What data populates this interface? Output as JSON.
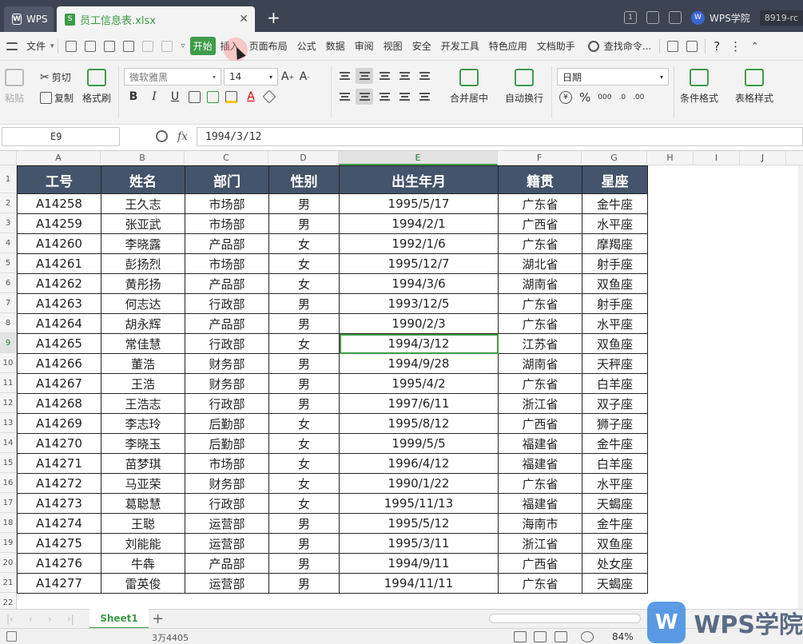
{
  "titlebar": {
    "app_tab": "WPS",
    "file_tab": "员工信息表.xlsx",
    "page_badge": "1",
    "academy": "WPS学院",
    "user": "8919-rc"
  },
  "menubar": {
    "file": "文件",
    "items": [
      "开始",
      "插入",
      "页面布局",
      "公式",
      "数据",
      "审阅",
      "视图",
      "安全",
      "开发工具",
      "特色应用",
      "文档助手"
    ],
    "search": "查找命令..."
  },
  "ribbon": {
    "paste": "粘贴",
    "cut": "剪切",
    "copy": "复制",
    "format_painter": "格式刷",
    "font_name": "微软雅黑",
    "font_size": "14",
    "bold": "B",
    "italic": "I",
    "underline": "U",
    "merge_center": "合并居中",
    "wrap_text": "自动换行",
    "number_format": "日期",
    "percent": "%",
    "conditional_format": "条件格式",
    "table_style": "表格样式"
  },
  "formula_bar": {
    "name_box": "E9",
    "fx": "fx",
    "value": "1994/3/12"
  },
  "grid": {
    "columns": [
      "A",
      "B",
      "C",
      "D",
      "E",
      "F",
      "G",
      "H",
      "I",
      "J"
    ],
    "selected_column": "E",
    "selected_row": 9,
    "rows": [
      "1",
      "2",
      "3",
      "4",
      "5",
      "6",
      "7",
      "8",
      "9",
      "10",
      "11",
      "12",
      "13",
      "14",
      "15",
      "16",
      "17",
      "18",
      "19",
      "20",
      "21",
      "22"
    ]
  },
  "table": {
    "headers": [
      "工号",
      "姓名",
      "部门",
      "性别",
      "出生年月",
      "籍贯",
      "星座"
    ],
    "rows": [
      [
        "A14258",
        "王久志",
        "市场部",
        "男",
        "1995/5/17",
        "广东省",
        "金牛座"
      ],
      [
        "A14259",
        "张亚武",
        "市场部",
        "男",
        "1994/2/1",
        "广西省",
        "水平座"
      ],
      [
        "A14260",
        "李晓露",
        "产品部",
        "女",
        "1992/1/6",
        "广东省",
        "摩羯座"
      ],
      [
        "A14261",
        "彭扬烈",
        "市场部",
        "女",
        "1995/12/7",
        "湖北省",
        "射手座"
      ],
      [
        "A14262",
        "黄彤扬",
        "产品部",
        "女",
        "1994/3/6",
        "湖南省",
        "双鱼座"
      ],
      [
        "A14263",
        "何志达",
        "行政部",
        "男",
        "1993/12/5",
        "广东省",
        "射手座"
      ],
      [
        "A14264",
        "胡永辉",
        "产品部",
        "男",
        "1990/2/3",
        "广东省",
        "水平座"
      ],
      [
        "A14265",
        "常佳慧",
        "行政部",
        "女",
        "1994/3/12",
        "江苏省",
        "双鱼座"
      ],
      [
        "A14266",
        "董浩",
        "财务部",
        "男",
        "1994/9/28",
        "湖南省",
        "天秤座"
      ],
      [
        "A14267",
        "王浩",
        "财务部",
        "男",
        "1995/4/2",
        "广东省",
        "白羊座"
      ],
      [
        "A14268",
        "王浩志",
        "行政部",
        "男",
        "1997/6/11",
        "浙江省",
        "双子座"
      ],
      [
        "A14269",
        "李志玲",
        "后勤部",
        "女",
        "1995/8/12",
        "广西省",
        "狮子座"
      ],
      [
        "A14270",
        "李晓玉",
        "后勤部",
        "女",
        "1999/5/5",
        "福建省",
        "金牛座"
      ],
      [
        "A14271",
        "苗梦琪",
        "市场部",
        "女",
        "1996/4/12",
        "福建省",
        "白羊座"
      ],
      [
        "A14272",
        "马亚荣",
        "财务部",
        "女",
        "1990/1/22",
        "广东省",
        "水平座"
      ],
      [
        "A14273",
        "葛聪慧",
        "行政部",
        "女",
        "1995/11/13",
        "福建省",
        "天蝎座"
      ],
      [
        "A14274",
        "王聪",
        "运营部",
        "男",
        "1995/5/12",
        "海南市",
        "金牛座"
      ],
      [
        "A14275",
        "刘能能",
        "运营部",
        "男",
        "1995/3/11",
        "浙江省",
        "双鱼座"
      ],
      [
        "A14276",
        "牛犇",
        "产品部",
        "男",
        "1994/9/11",
        "广西省",
        "处女座"
      ],
      [
        "A14277",
        "雷英俊",
        "运营部",
        "男",
        "1994/11/11",
        "广东省",
        "天蝎座"
      ]
    ]
  },
  "sheetbar": {
    "sheet": "Sheet1",
    "add": "+"
  },
  "statusbar": {
    "info": "3万4405",
    "zoom": "84%"
  },
  "watermark": {
    "logo": "W",
    "text": "WPS学院"
  },
  "colors": {
    "accent": "#3f9b4a",
    "header_fill": "#44546a",
    "titlebar": "#3c4352"
  }
}
